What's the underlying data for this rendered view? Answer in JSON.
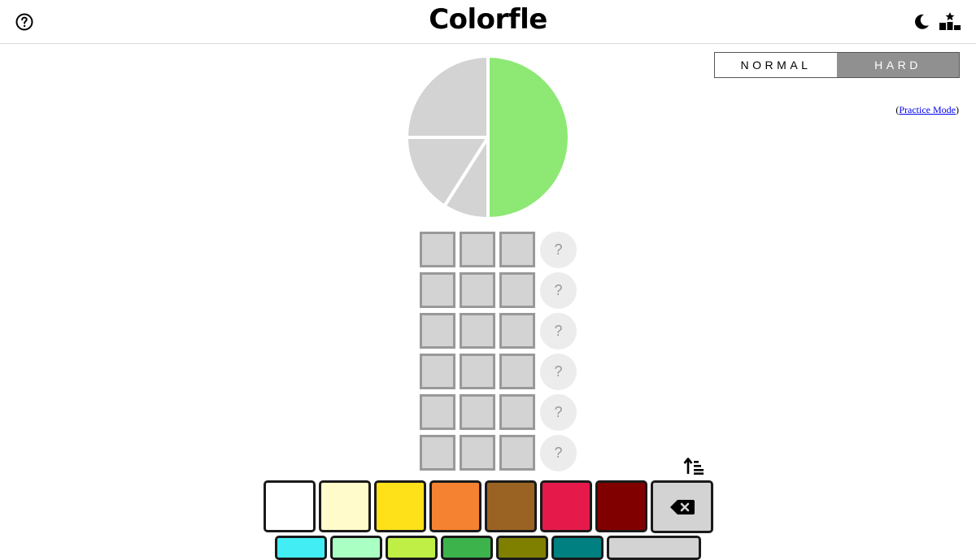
{
  "header": {
    "title": "Colorfle",
    "help_icon": "question-circle-icon",
    "theme_icon": "moon-icon",
    "stats_icon": "leaderboard-icon"
  },
  "mode": {
    "options": [
      "NORMAL",
      "HARD"
    ],
    "selected": "HARD"
  },
  "practice": {
    "open": "(",
    "link": "Practice Mode",
    "close": ")"
  },
  "target": {
    "slice_fractions": [
      0.5,
      0.09,
      0.16,
      0.25
    ],
    "slice_colors": [
      "#8de874",
      "#d3d3d3",
      "#d3d3d3",
      "#d3d3d3"
    ]
  },
  "board": {
    "rows": [
      {
        "hint": "?"
      },
      {
        "hint": "?"
      },
      {
        "hint": "?"
      },
      {
        "hint": "?"
      },
      {
        "hint": "?"
      },
      {
        "hint": "?"
      }
    ],
    "cells_per_row": 3
  },
  "keyboard": {
    "sort_icon": "sort-ascending-icon",
    "row1": [
      {
        "name": "white",
        "color": "#ffffff"
      },
      {
        "name": "cream",
        "color": "#fffbcb"
      },
      {
        "name": "yellow",
        "color": "#ffe11a"
      },
      {
        "name": "orange",
        "color": "#f58231"
      },
      {
        "name": "brown",
        "color": "#9a6324"
      },
      {
        "name": "crimson",
        "color": "#e6194b"
      },
      {
        "name": "maroon",
        "color": "#800000"
      }
    ],
    "row2": [
      {
        "name": "cyan",
        "color": "#42eef4"
      },
      {
        "name": "mint",
        "color": "#aaffc3"
      },
      {
        "name": "lime",
        "color": "#bfef45"
      },
      {
        "name": "green",
        "color": "#3cb44b"
      },
      {
        "name": "olive",
        "color": "#808000"
      },
      {
        "name": "teal",
        "color": "#008080"
      }
    ],
    "backspace_icon": "backspace-icon"
  }
}
